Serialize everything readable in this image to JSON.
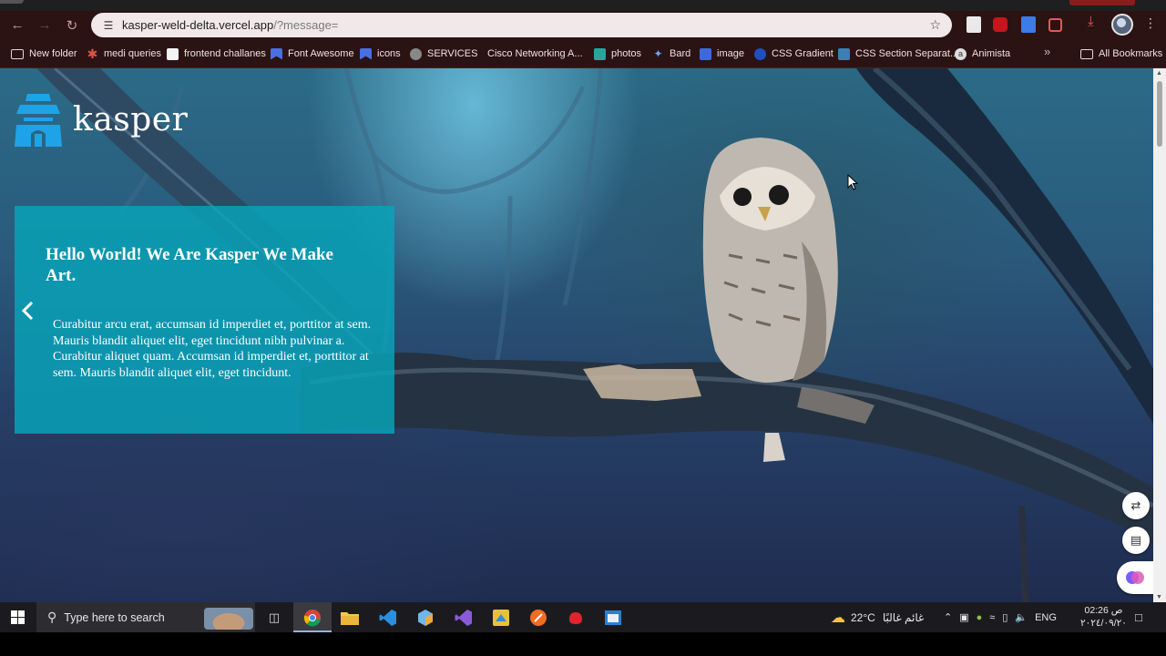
{
  "browser": {
    "url_host": "kasper-weld-delta.vercel.app",
    "url_path": "/?message="
  },
  "bookmarks": [
    {
      "label": "New folder",
      "icon": "folder-icon"
    },
    {
      "label": "medi queries",
      "icon": "asterisk-icon"
    },
    {
      "label": "frontend challanes",
      "icon": "page-icon"
    },
    {
      "label": "Font Awesome",
      "icon": "flag-icon"
    },
    {
      "label": "icons",
      "icon": "flag-icon"
    },
    {
      "label": "SERVICES",
      "icon": "globe-icon"
    },
    {
      "label": "Cisco Networking A...",
      "icon": "cisco-icon"
    },
    {
      "label": "photos",
      "icon": "photos-icon"
    },
    {
      "label": "Bard",
      "icon": "sparkle-icon"
    },
    {
      "label": "image",
      "icon": "doc-icon"
    },
    {
      "label": "CSS Gradient",
      "icon": "circle-icon"
    },
    {
      "label": "CSS Section Separat...",
      "icon": "code-icon"
    },
    {
      "label": "Animista",
      "icon": "a-icon"
    }
  ],
  "bookmarks_all": "All Bookmarks",
  "page": {
    "logo_text": "kasper",
    "hero_title": "Hello World! We Are Kasper We Make Art.",
    "hero_text": "Curabitur arcu erat, accumsan id imperdiet et, porttitor at sem. Mauris blandit aliquet elit, eget tincidunt nibh pulvinar a. Curabitur aliquet quam. Accumsan id imperdiet et, porttitor at sem. Mauris blandit aliquet elit, eget tincidunt."
  },
  "taskbar": {
    "search_placeholder": "Type here to search",
    "weather_temp": "22°C",
    "weather_text": "غائم غالبًا",
    "lang": "ENG",
    "time": "02:26 ص",
    "date": "٢٠٢٤/٠٩/٢٠"
  },
  "colors": {
    "hero_box": "#07a5b9",
    "logo_blue": "#1fa3e8"
  }
}
